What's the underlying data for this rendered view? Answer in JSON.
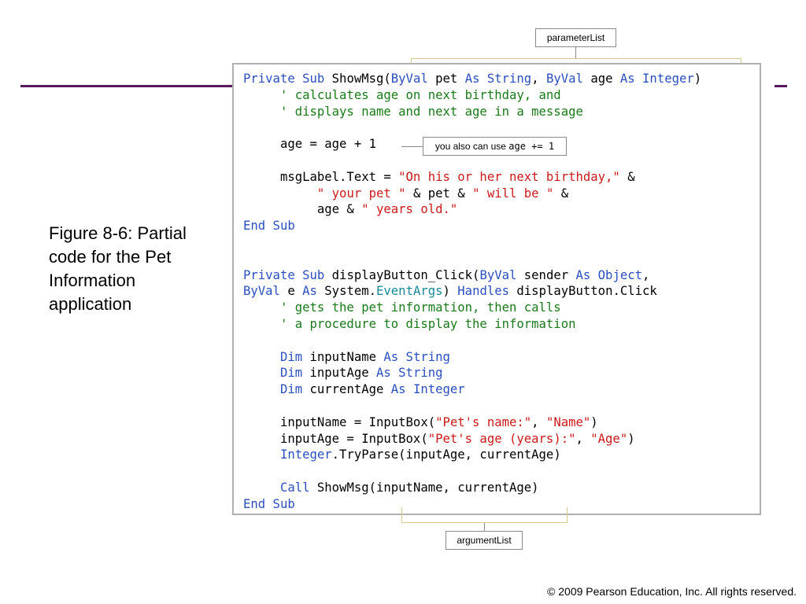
{
  "caption": {
    "text": "Figure 8-6: Partial code for the Pet Information application"
  },
  "callouts": {
    "parameter_list": "parameterList",
    "argument_list": "argumentList",
    "tip_prefix": "you also can use ",
    "tip_code": "age += 1"
  },
  "code": {
    "lines": [
      [
        [
          "kw",
          "Private Sub "
        ],
        [
          "pl",
          "ShowMsg("
        ],
        [
          "kw",
          "ByVal "
        ],
        [
          "pl",
          "pet "
        ],
        [
          "kw",
          "As String"
        ],
        [
          "pl",
          ", "
        ],
        [
          "kw",
          "ByVal "
        ],
        [
          "pl",
          "age "
        ],
        [
          "kw",
          "As Integer"
        ],
        [
          "pl",
          ")"
        ]
      ],
      [
        [
          "cm",
          "     ' calculates age on next birthday, and"
        ]
      ],
      [
        [
          "cm",
          "     ' displays name and next age in a message"
        ]
      ],
      [],
      [
        [
          "pl",
          "     age = age + 1"
        ]
      ],
      [],
      [
        [
          "pl",
          "     msgLabel.Text = "
        ],
        [
          "str",
          "\"On his or her next birthday,\""
        ],
        [
          "pl",
          " &"
        ]
      ],
      [
        [
          "pl",
          "          "
        ],
        [
          "str",
          "\" your pet \""
        ],
        [
          "pl",
          " & pet & "
        ],
        [
          "str",
          "\" will be \""
        ],
        [
          "pl",
          " &"
        ]
      ],
      [
        [
          "pl",
          "          age & "
        ],
        [
          "str",
          "\" years old.\""
        ]
      ],
      [
        [
          "kw",
          "End Sub"
        ]
      ],
      [],
      [],
      [
        [
          "kw",
          "Private Sub "
        ],
        [
          "pl",
          "displayButton_Click("
        ],
        [
          "kw",
          "ByVal "
        ],
        [
          "pl",
          "sender "
        ],
        [
          "kw",
          "As Object"
        ],
        [
          "pl",
          ","
        ]
      ],
      [
        [
          "kw",
          "ByVal "
        ],
        [
          "pl",
          "e "
        ],
        [
          "kw",
          "As "
        ],
        [
          "pl",
          "System."
        ],
        [
          "ty",
          "EventArgs"
        ],
        [
          "pl",
          ") "
        ],
        [
          "kw",
          "Handles "
        ],
        [
          "pl",
          "displayButton.Click"
        ]
      ],
      [
        [
          "cm",
          "     ' gets the pet information, then calls"
        ]
      ],
      [
        [
          "cm",
          "     ' a procedure to display the information"
        ]
      ],
      [],
      [
        [
          "kw",
          "     Dim "
        ],
        [
          "pl",
          "inputName "
        ],
        [
          "kw",
          "As String"
        ]
      ],
      [
        [
          "kw",
          "     Dim "
        ],
        [
          "pl",
          "inputAge "
        ],
        [
          "kw",
          "As String"
        ]
      ],
      [
        [
          "kw",
          "     Dim "
        ],
        [
          "pl",
          "currentAge "
        ],
        [
          "kw",
          "As Integer"
        ]
      ],
      [],
      [
        [
          "pl",
          "     inputName = InputBox("
        ],
        [
          "str",
          "\"Pet's name:\""
        ],
        [
          "pl",
          ", "
        ],
        [
          "str",
          "\"Name\""
        ],
        [
          "pl",
          ")"
        ]
      ],
      [
        [
          "pl",
          "     inputAge = InputBox("
        ],
        [
          "str",
          "\"Pet's age (years):\""
        ],
        [
          "pl",
          ", "
        ],
        [
          "str",
          "\"Age\""
        ],
        [
          "pl",
          ")"
        ]
      ],
      [
        [
          "kw",
          "     Integer"
        ],
        [
          "pl",
          ".TryParse(inputAge, currentAge)"
        ]
      ],
      [],
      [
        [
          "kw",
          "     Call "
        ],
        [
          "pl",
          "ShowMsg(inputName, currentAge)"
        ]
      ],
      [
        [
          "kw",
          "End Sub"
        ]
      ]
    ]
  },
  "footer": {
    "copyright": "© 2009 Pearson Education, Inc.  All rights reserved."
  }
}
